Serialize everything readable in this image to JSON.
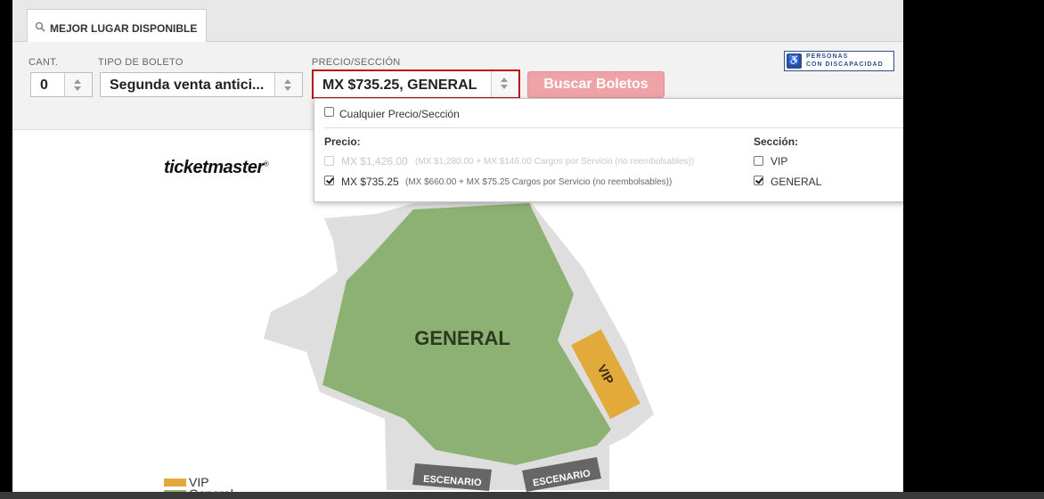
{
  "tab": {
    "label": "MEJOR LUGAR DISPONIBLE"
  },
  "filters": {
    "cant_label": "CANT.",
    "cant_value": "0",
    "tipo_label": "TIPO DE BOLETO",
    "tipo_value": "Segunda venta antici...",
    "precio_label": "PRECIO/SECCIÓN",
    "precio_value": "MX $735.25, GENERAL",
    "search_button": "Buscar Boletos"
  },
  "accessibility": {
    "line1": "PERSONAS",
    "line2": "CON DISCAPACIDAD"
  },
  "dropdown": {
    "any_label": "Cualquier Precio/Sección",
    "price_header": "Precio:",
    "section_header": "Sección:",
    "prices": [
      {
        "amount": "MX $1,426.00",
        "detail": "(MX $1,280.00 + MX $146.00 Cargos por Servicio (no reembolsables))",
        "checked": false,
        "disabled": true
      },
      {
        "amount": "MX $735.25",
        "detail": "(MX $660.00 + MX $75.25 Cargos por Servicio (no reembolsables))",
        "checked": true,
        "disabled": false
      }
    ],
    "sections": [
      {
        "name": "VIP",
        "checked": false
      },
      {
        "name": "GENERAL",
        "checked": true
      }
    ]
  },
  "logo": {
    "text": "ticketmaster",
    "mark": "®"
  },
  "map": {
    "general_label": "GENERAL",
    "vip_label": "VIP",
    "stage_left": "ESCENARIO",
    "stage_right": "ESCENARIO",
    "colors": {
      "general": "#8db173",
      "vip": "#e2a93b",
      "stage": "#666666",
      "venue": "#dedede"
    }
  },
  "legend": {
    "vip": "VIP",
    "general": "General"
  }
}
